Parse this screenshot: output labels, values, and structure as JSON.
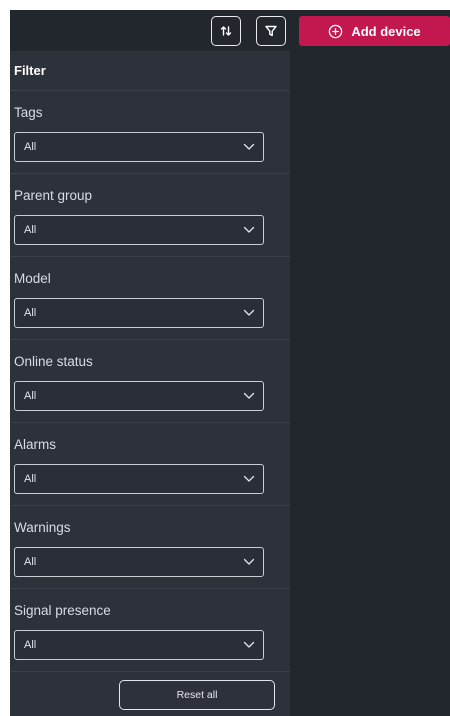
{
  "toolbar": {
    "sort_icon": "sort-arrows-icon",
    "filter_icon": "funnel-icon",
    "add_device_label": "Add device",
    "add_device_icon": "plus-circle-icon",
    "accent_color": "#c3174f"
  },
  "filter_panel": {
    "title": "Filter",
    "sections": [
      {
        "label": "Tags",
        "value": "All"
      },
      {
        "label": "Parent group",
        "value": "All"
      },
      {
        "label": "Model",
        "value": "All"
      },
      {
        "label": "Online status",
        "value": "All"
      },
      {
        "label": "Alarms",
        "value": "All"
      },
      {
        "label": "Warnings",
        "value": "All"
      },
      {
        "label": "Signal presence",
        "value": "All"
      }
    ],
    "reset_label": "Reset all"
  }
}
